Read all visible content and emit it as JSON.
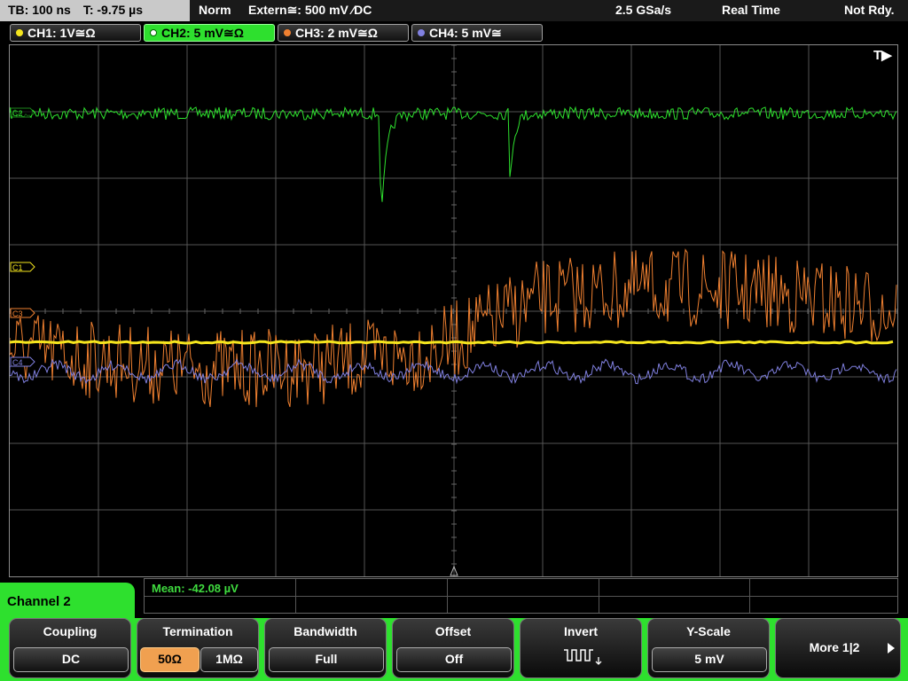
{
  "status": {
    "timebase": "TB: 100 ns",
    "trigger_time": "T: -9.75 µs",
    "mode": "Norm",
    "trigger_source": "Extern≅: 500 mV ⁄DC",
    "sample_rate": "2.5 GSa/s",
    "acq_mode": "Real Time",
    "state": "Not Rdy."
  },
  "channels": [
    {
      "label": "CH1: 1V≅Ω",
      "color": "#f5e61e"
    },
    {
      "label": "CH2: 5 mV≅Ω",
      "color": "#2ee02e"
    },
    {
      "label": "CH3: 2 mV≅Ω",
      "color": "#f08030"
    },
    {
      "label": "CH4: 5 mV≅",
      "color": "#8080e0"
    }
  ],
  "markers": {
    "trigger": "T▶",
    "c1": "C1",
    "c3": "C3",
    "c4": "C4",
    "c2": "C2"
  },
  "measurement": {
    "mean": "Mean: -42.08 µV"
  },
  "menu": {
    "title": "Channel 2",
    "keys": [
      {
        "label": "Coupling",
        "value": "DC"
      },
      {
        "label": "Termination",
        "options": [
          "50Ω",
          "1MΩ"
        ],
        "selected": "50Ω"
      },
      {
        "label": "Bandwidth",
        "value": "Full"
      },
      {
        "label": "Offset",
        "value": "Off"
      },
      {
        "label": "Invert",
        "icon": "invert-wave-icon"
      },
      {
        "label": "Y-Scale",
        "value": "5 mV"
      },
      {
        "label": "More 1|2",
        "icon": "right-arrow-icon"
      }
    ]
  }
}
